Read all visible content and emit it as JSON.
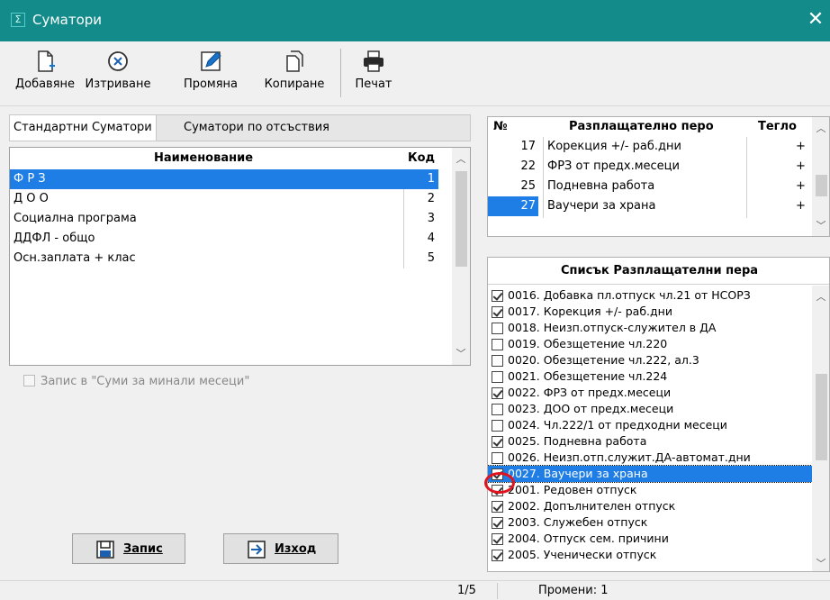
{
  "window": {
    "title": "Суматори",
    "app_icon": "Σ",
    "close_glyph": "✕"
  },
  "toolbar": {
    "add": "Добавяне",
    "delete": "Изтриване",
    "edit": "Промяна",
    "copy": "Копиране",
    "print": "Печат"
  },
  "tabs": {
    "standard": "Стандартни Суматори",
    "absence": "Суматори по отсъствия"
  },
  "summators": {
    "col_name": "Наименование",
    "col_code": "Код",
    "rows": [
      {
        "name": "Ф Р З",
        "code": "1"
      },
      {
        "name": "Д О О",
        "code": "2"
      },
      {
        "name": "Социална програма",
        "code": "3"
      },
      {
        "name": "ДДФЛ - общо",
        "code": "4"
      },
      {
        "name": "Осн.заплата + клас",
        "code": "5"
      }
    ],
    "selected_index": 0
  },
  "past_months_option": {
    "label": "Запис в \"Суми за минали месеци\"",
    "checked": false
  },
  "assigned": {
    "col_no": "№",
    "col_item": "Разплащателно перо",
    "col_weight": "Тегло",
    "rows": [
      {
        "no": "17",
        "item": "Корекция +/- раб.дни",
        "weight": "+"
      },
      {
        "no": "22",
        "item": "ФРЗ от предх.месеци",
        "weight": "+"
      },
      {
        "no": "25",
        "item": "Подневна работа",
        "weight": "+"
      },
      {
        "no": "27",
        "item": "Ваучери за храна",
        "weight": "+"
      }
    ],
    "selected_index": 3
  },
  "pay_items": {
    "header": "Списък Разплащателни пера",
    "items": [
      {
        "label": "0016. Добавка пл.отпуск чл.21 от НСОРЗ",
        "checked": true
      },
      {
        "label": "0017. Корекция +/- раб.дни",
        "checked": true
      },
      {
        "label": "0018. Неизп.отпуск-служител в ДА",
        "checked": false
      },
      {
        "label": "0019. Обезщетение чл.220",
        "checked": false
      },
      {
        "label": "0020. Обезщетение чл.222, ал.3",
        "checked": false
      },
      {
        "label": "0021. Обезщетение чл.224",
        "checked": false
      },
      {
        "label": "0022. ФРЗ от предх.месеци",
        "checked": true
      },
      {
        "label": "0023. ДОО от предх.месеци",
        "checked": false
      },
      {
        "label": "0024. Чл.222/1 от предходни месеци",
        "checked": false
      },
      {
        "label": "0025. Подневна работа",
        "checked": true
      },
      {
        "label": "0026. Неизп.отп.служит.ДА-автомат.дни",
        "checked": false
      },
      {
        "label": "0027. Ваучери за храна",
        "checked": true
      },
      {
        "label": "2001. Редовен отпуск",
        "checked": true
      },
      {
        "label": "2002. Допълнителен отпуск",
        "checked": true
      },
      {
        "label": "2003. Служебен отпуск",
        "checked": true
      },
      {
        "label": "2004. Отпуск сем. причини",
        "checked": true
      },
      {
        "label": "2005. Ученически отпуск",
        "checked": true
      }
    ],
    "selected_index": 11
  },
  "buttons": {
    "save": "Запис",
    "exit": "Изход"
  },
  "status": {
    "position": "1/5",
    "changes": "Промени: 1"
  },
  "colors": {
    "titlebar": "#138b8b",
    "selection": "#1e7ee6",
    "highlight_circle": "#e0141e"
  }
}
